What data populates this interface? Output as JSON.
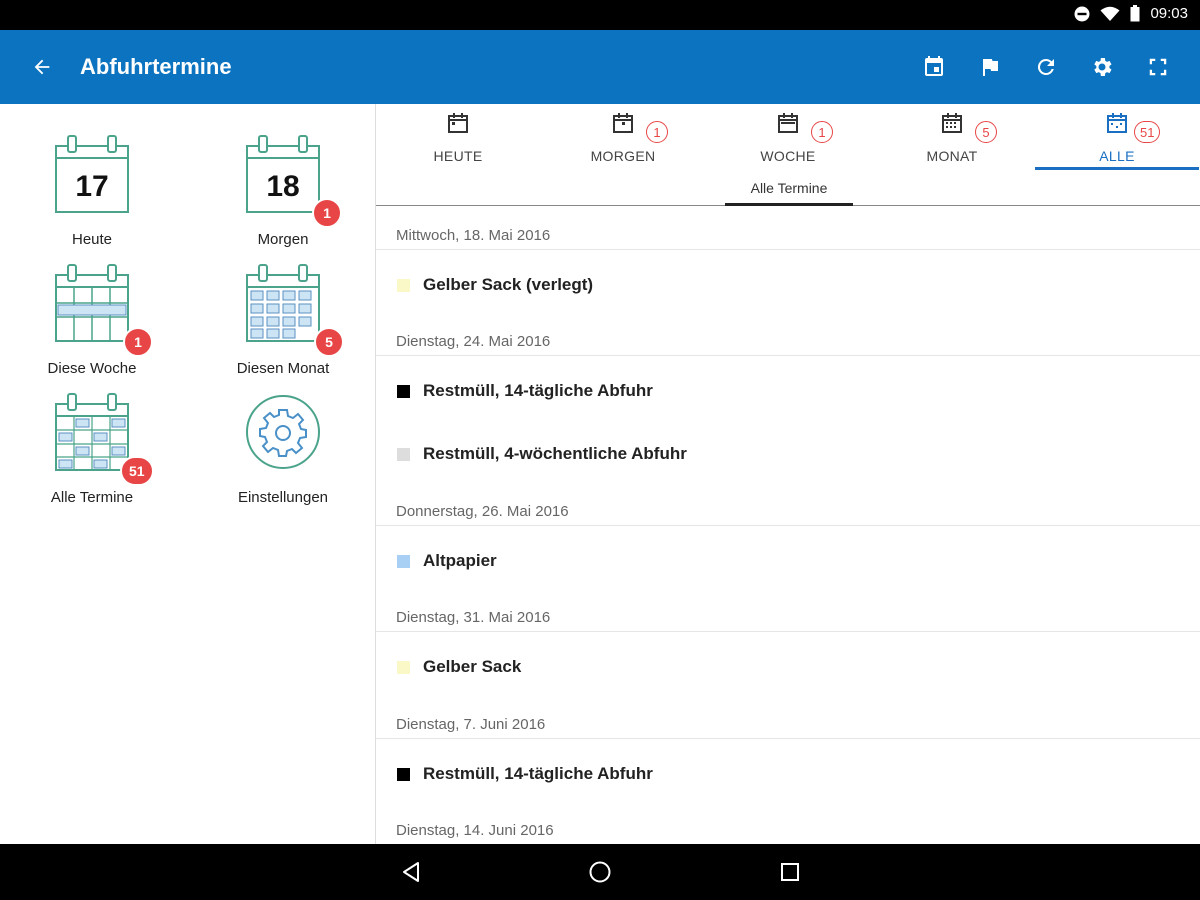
{
  "status_bar": {
    "time": "09:03",
    "icons": [
      "dnd-icon",
      "wifi-icon",
      "battery-icon"
    ]
  },
  "app_bar": {
    "title": "Abfuhrtermine",
    "back_icon": "arrow-left-icon",
    "actions": [
      "calendar-today-icon",
      "flag-icon",
      "refresh-icon",
      "settings-icon",
      "fullscreen-icon"
    ]
  },
  "left_panel": {
    "tiles": [
      {
        "label": "Heute",
        "day": "17",
        "badge": ""
      },
      {
        "label": "Morgen",
        "day": "18",
        "badge": "1"
      },
      {
        "label": "Diese Woche",
        "badge": "1"
      },
      {
        "label": "Diesen Monat",
        "badge": "5"
      },
      {
        "label": "Alle Termine",
        "badge": "51"
      },
      {
        "label": "Einstellungen",
        "badge": ""
      }
    ]
  },
  "tabs": [
    {
      "label": "HEUTE",
      "count": ""
    },
    {
      "label": "MORGEN",
      "count": "1"
    },
    {
      "label": "WOCHE",
      "count": "1"
    },
    {
      "label": "MONAT",
      "count": "5"
    },
    {
      "label": "ALLE",
      "count": "51",
      "active": true
    }
  ],
  "subtab": {
    "label": "Alle Termine"
  },
  "list": {
    "groups": [
      {
        "date": "Mittwoch, 18. Mai 2016",
        "entries": [
          {
            "text": "Gelber Sack (verlegt)",
            "color": "#fbf8c8"
          }
        ]
      },
      {
        "date": "Dienstag, 24. Mai 2016",
        "entries": [
          {
            "text": "Restmüll, 14-tägliche Abfuhr",
            "color": "#000000"
          },
          {
            "text": "Restmüll, 4-wöchentliche Abfuhr",
            "color": "#dddddd"
          }
        ]
      },
      {
        "date": "Donnerstag, 26. Mai 2016",
        "entries": [
          {
            "text": "Altpapier",
            "color": "#a8d0f5"
          }
        ]
      },
      {
        "date": "Dienstag, 31. Mai 2016",
        "entries": [
          {
            "text": "Gelber Sack",
            "color": "#fbf8c8"
          }
        ]
      },
      {
        "date": "Dienstag, 7. Juni 2016",
        "entries": [
          {
            "text": "Restmüll, 14-tägliche Abfuhr",
            "color": "#000000"
          }
        ]
      },
      {
        "date": "Dienstag, 14. Juni 2016",
        "entries": []
      }
    ]
  },
  "colors": {
    "primary": "#0b73bf",
    "badge": "#e84646",
    "tile_icon": "#4aa38a",
    "active_tab": "#1a6fc2"
  }
}
